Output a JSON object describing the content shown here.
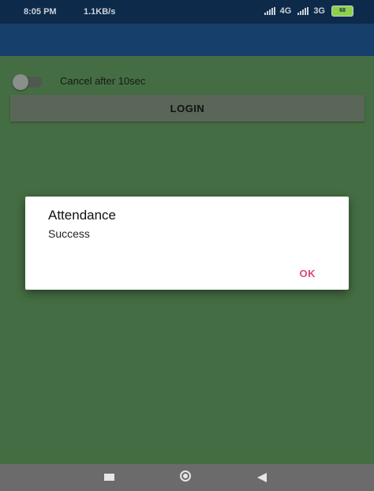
{
  "status_bar": {
    "time": "8:05 PM",
    "speed": "1.1KB/s",
    "network_1": "4G",
    "network_2": "3G",
    "battery_level": "68"
  },
  "main": {
    "toggle_label": "Cancel after 10sec",
    "toggle_on": false,
    "login_label": "LOGIN"
  },
  "dialog": {
    "title": "Attendance",
    "message": "Success",
    "ok_label": "OK"
  },
  "colors": {
    "status_bar": "#0d2a4a",
    "app_bar": "#163f6b",
    "background": "#456d43",
    "accent": "#e0457c"
  },
  "nav_bar": {
    "icons": [
      "recent-apps-icon",
      "home-icon",
      "back-icon"
    ]
  }
}
